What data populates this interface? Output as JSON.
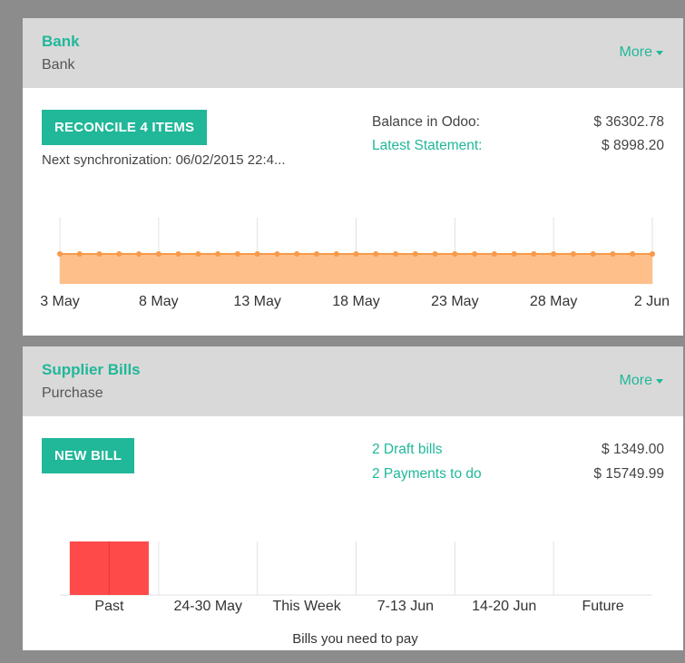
{
  "bank": {
    "title": "Bank",
    "subtitle": "Bank",
    "more_label": "More",
    "reconcile_label": "RECONCILE 4 ITEMS",
    "sync_note": "Next synchronization: 06/02/2015 22:4...",
    "balance_label": "Balance in Odoo:",
    "balance_value": "$ 36302.78",
    "statement_label": "Latest Statement:",
    "statement_value": "$ 8998.20"
  },
  "bills": {
    "title": "Supplier Bills",
    "subtitle": "Purchase",
    "more_label": "More",
    "new_bill_label": "NEW BILL",
    "draft_label": "2 Draft bills",
    "draft_value": "$ 1349.00",
    "payments_label": "2 Payments to do",
    "payments_value": "$ 15749.99"
  },
  "colors": {
    "accent": "#21b799",
    "line_fill": "#ffbf8a",
    "line_stroke": "#f79a4a",
    "bar_fill": "#ff4a4a"
  },
  "chart_data": [
    {
      "type": "area",
      "x_tick_labels": [
        "3 May",
        "8 May",
        "13 May",
        "18 May",
        "23 May",
        "28 May",
        "2 Jun"
      ],
      "x_start": "3 May",
      "x_end": "2 Jun",
      "points": 31,
      "y_values_flat": true,
      "grid": true
    },
    {
      "type": "bar",
      "categories": [
        "Past",
        "24-30 May",
        "This Week",
        "7-13 Jun",
        "14-20 Jun",
        "Future"
      ],
      "values": [
        1,
        0,
        0,
        0,
        0,
        0
      ],
      "xlabel": "Bills you need to pay",
      "grid": true
    }
  ]
}
